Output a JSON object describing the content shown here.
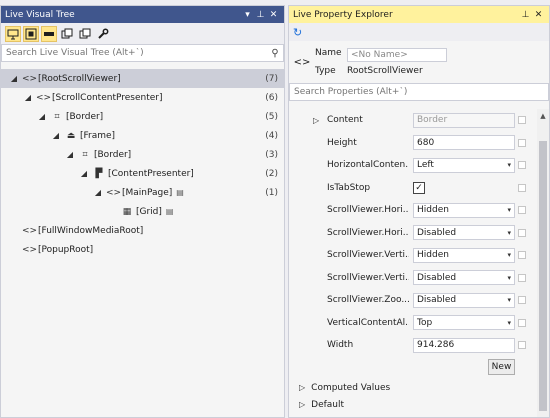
{
  "lvt": {
    "title": "Live Visual Tree",
    "search_placeholder": "Search Live Visual Tree (Alt+`)",
    "tree": [
      {
        "label": "[RootScrollViewer]",
        "count": "(7)",
        "depth": 0,
        "expanded": true,
        "selected": true,
        "icon": "code-brackets-icon",
        "icon_char": "<>"
      },
      {
        "label": "[ScrollContentPresenter]",
        "count": "(6)",
        "depth": 1,
        "expanded": true,
        "icon": "code-brackets-icon",
        "icon_char": "<>"
      },
      {
        "label": "[Border]",
        "count": "(5)",
        "depth": 2,
        "expanded": true,
        "icon": "border-icon",
        "icon_char": "⌗"
      },
      {
        "label": "[Frame]",
        "count": "(4)",
        "depth": 3,
        "expanded": true,
        "icon": "frame-icon",
        "icon_char": "⏏"
      },
      {
        "label": "[Border]",
        "count": "(3)",
        "depth": 4,
        "expanded": true,
        "icon": "border-icon",
        "icon_char": "⌗"
      },
      {
        "label": "[ContentPresenter]",
        "count": "(2)",
        "depth": 5,
        "expanded": true,
        "icon": "content-presenter-icon",
        "icon_char": "▛"
      },
      {
        "label": "[MainPage]",
        "count": "(1)",
        "depth": 6,
        "expanded": true,
        "icon": "code-brackets-icon",
        "icon_char": "<>",
        "badge": "▤"
      },
      {
        "label": "[Grid]",
        "count": "",
        "depth": 7,
        "expanded": false,
        "leaf": true,
        "icon": "grid-icon",
        "icon_char": "▦",
        "badge": "▤"
      },
      {
        "label": "[FullWindowMediaRoot]",
        "count": "",
        "depth": 0,
        "expanded": false,
        "leaf": true,
        "icon": "code-brackets-icon",
        "icon_char": "<>"
      },
      {
        "label": "[PopupRoot]",
        "count": "",
        "depth": 0,
        "expanded": false,
        "leaf": true,
        "icon": "code-brackets-icon",
        "icon_char": "<>"
      }
    ]
  },
  "lpe": {
    "title": "Live Property Explorer",
    "name_label": "Name",
    "name_value": "<No Name>",
    "type_label": "Type",
    "type_value": "RootScrollViewer",
    "search_placeholder": "Search Properties (Alt+`)",
    "properties": [
      {
        "name": "Content",
        "value": "Border",
        "kind": "disabled",
        "expander": true
      },
      {
        "name": "Height",
        "value": "680",
        "kind": "text"
      },
      {
        "name": "HorizontalConten...",
        "value": "Left",
        "kind": "dropdown"
      },
      {
        "name": "IsTabStop",
        "value": "✓",
        "kind": "checkbox"
      },
      {
        "name": "ScrollViewer.Hori...",
        "value": "Hidden",
        "kind": "dropdown"
      },
      {
        "name": "ScrollViewer.Hori...",
        "value": "Disabled",
        "kind": "dropdown"
      },
      {
        "name": "ScrollViewer.Verti...",
        "value": "Hidden",
        "kind": "dropdown"
      },
      {
        "name": "ScrollViewer.Verti...",
        "value": "Disabled",
        "kind": "dropdown"
      },
      {
        "name": "ScrollViewer.Zoo...",
        "value": "Disabled",
        "kind": "dropdown"
      },
      {
        "name": "VerticalContentAl...",
        "value": "Top",
        "kind": "dropdown"
      },
      {
        "name": "Width",
        "value": "914.286",
        "kind": "text"
      }
    ],
    "new_button": "New",
    "sections": [
      "Computed Values",
      "Default"
    ]
  },
  "glyphs": {
    "dropdown_arrow": "▾",
    "expanded": "◢",
    "collapsed": "▷",
    "pin": "⊥",
    "close": "✕",
    "menu": "▾",
    "search": "⚲",
    "refresh": "↻",
    "code": "<>"
  },
  "colors": {
    "inactive_title": "#40568d",
    "active_title": "#fff29d",
    "selection": "#ccced8",
    "refresh_blue": "#1e6fd9"
  }
}
